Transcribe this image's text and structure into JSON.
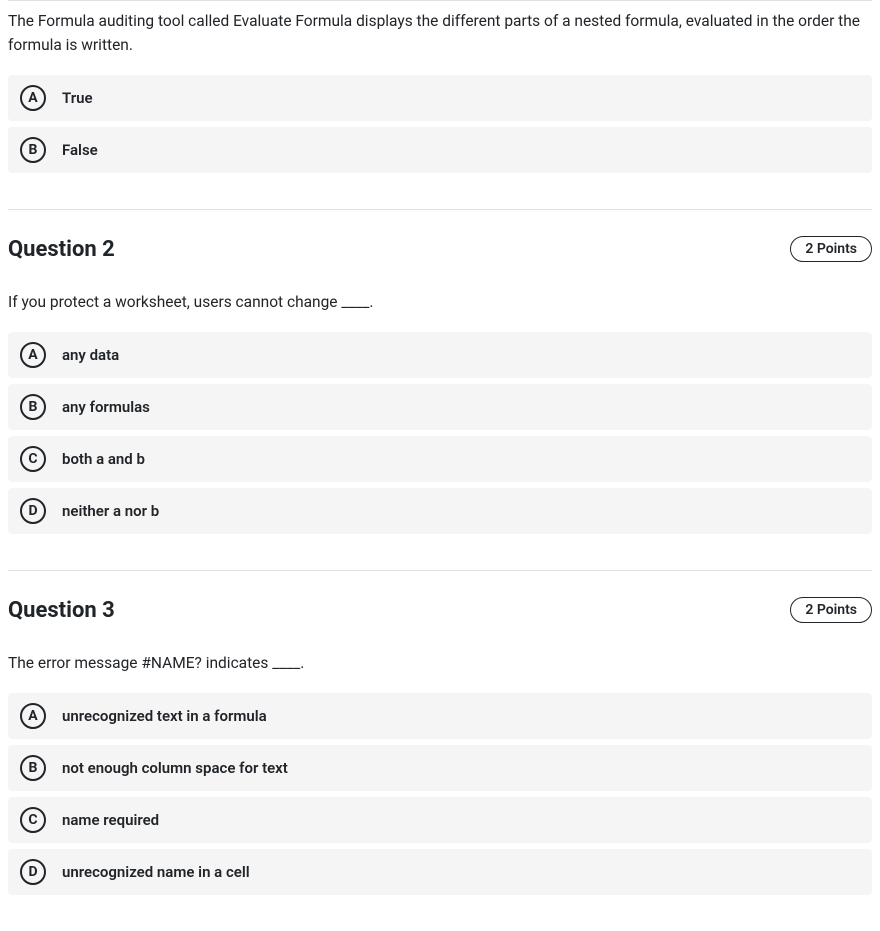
{
  "questions": [
    {
      "header": null,
      "points": null,
      "text": "The Formula auditing tool called Evaluate Formula displays the different parts of a nested formula, evaluated in the order the formula is written.",
      "options": [
        {
          "letter": "A",
          "label": "True"
        },
        {
          "letter": "B",
          "label": "False"
        }
      ]
    },
    {
      "header": "Question 2",
      "points": "2 Points",
      "text": "If you protect a worksheet, users cannot change ____.",
      "options": [
        {
          "letter": "A",
          "label": "any data"
        },
        {
          "letter": "B",
          "label": "any formulas"
        },
        {
          "letter": "C",
          "label": "both a and b"
        },
        {
          "letter": "D",
          "label": "neither a nor b"
        }
      ]
    },
    {
      "header": "Question 3",
      "points": "2 Points",
      "text": "The error message #NAME? indicates ____.",
      "options": [
        {
          "letter": "A",
          "label": "unrecognized text in a formula"
        },
        {
          "letter": "B",
          "label": "not enough column space for text"
        },
        {
          "letter": "C",
          "label": "name required"
        },
        {
          "letter": "D",
          "label": "unrecognized name in a cell"
        }
      ]
    }
  ]
}
